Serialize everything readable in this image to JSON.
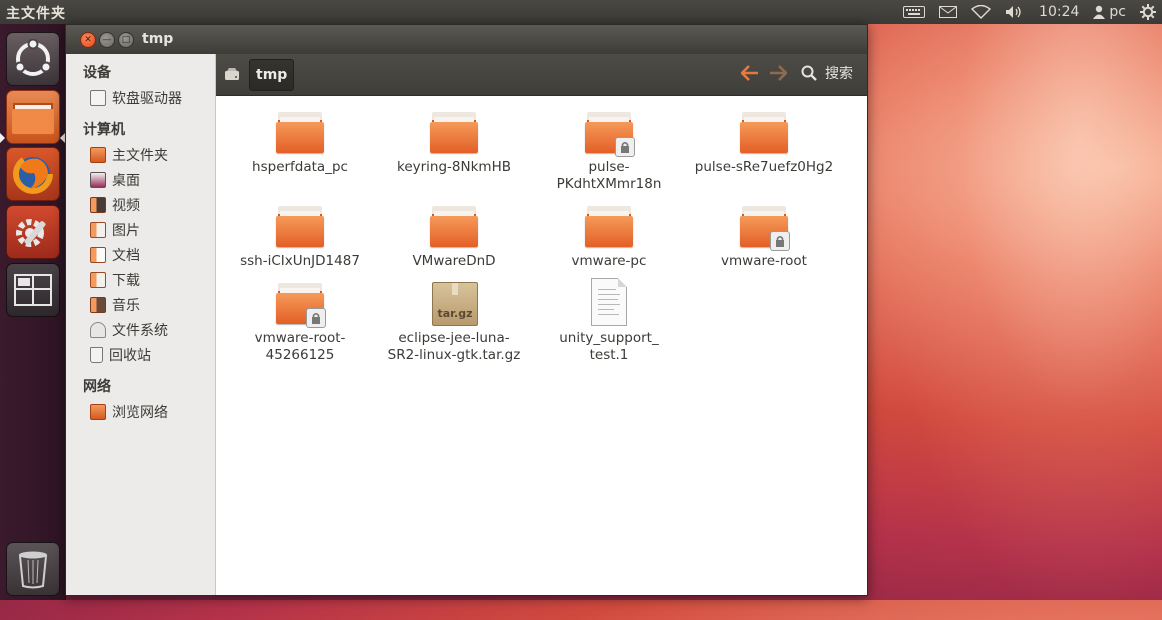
{
  "top_panel": {
    "title": "主文件夹",
    "clock": "10:24",
    "user": "pc"
  },
  "window": {
    "title": "tmp"
  },
  "sidebar": {
    "headings": {
      "devices": "设备",
      "computer": "计算机",
      "network": "网络"
    },
    "devices": [
      {
        "label": "软盘驱动器",
        "icon": "floppy-icon"
      }
    ],
    "computer": [
      {
        "label": "主文件夹",
        "icon": "home-folder-icon"
      },
      {
        "label": "桌面",
        "icon": "desktop-icon"
      },
      {
        "label": "视频",
        "icon": "video-icon"
      },
      {
        "label": "图片",
        "icon": "pictures-icon"
      },
      {
        "label": "文档",
        "icon": "documents-icon"
      },
      {
        "label": "下载",
        "icon": "downloads-icon"
      },
      {
        "label": "音乐",
        "icon": "music-icon"
      },
      {
        "label": "文件系统",
        "icon": "filesystem-icon"
      },
      {
        "label": "回收站",
        "icon": "trash-icon"
      }
    ],
    "network": [
      {
        "label": "浏览网络",
        "icon": "network-icon"
      }
    ]
  },
  "toolbar": {
    "path_label": "tmp",
    "search_label": "搜索"
  },
  "files": [
    {
      "name": "hsperfdata_pc",
      "type": "folder",
      "locked": false
    },
    {
      "name": "keyring-8NkmHB",
      "type": "folder",
      "locked": false
    },
    {
      "name_lines": [
        "pulse-",
        "PKdhtXMmr18n"
      ],
      "type": "folder",
      "locked": true
    },
    {
      "name": "pulse-sRe7uefz0Hg2",
      "type": "folder",
      "locked": false
    },
    {
      "name": "ssh-iCIxUnJD1487",
      "type": "folder",
      "locked": false
    },
    {
      "name": "VMwareDnD",
      "type": "folder",
      "locked": false
    },
    {
      "name": "vmware-pc",
      "type": "folder",
      "locked": false
    },
    {
      "name": "vmware-root",
      "type": "folder",
      "locked": true
    },
    {
      "name_lines": [
        "vmware-root-",
        "45266125"
      ],
      "type": "folder",
      "locked": true
    },
    {
      "name_lines": [
        "eclipse-jee-luna-",
        "SR2-linux-gtk.tar.gz"
      ],
      "type": "archive",
      "icon_label": "tar.gz"
    },
    {
      "name_lines": [
        "unity_support_",
        "test.1"
      ],
      "type": "text-file"
    }
  ],
  "colors": {
    "accent": "#dd4814",
    "panel": "#3c3b37",
    "sidebar": "#ecebe9"
  }
}
